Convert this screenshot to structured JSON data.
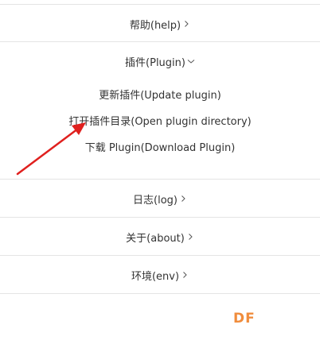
{
  "menu": {
    "help": {
      "label": "帮助(help)",
      "chevron": "chevron-right-icon"
    },
    "plugin": {
      "label": "插件(Plugin)",
      "chevron": "chevron-down-icon",
      "expanded": true,
      "items": [
        {
          "label": "更新插件(Update plugin)"
        },
        {
          "label": "打开插件目录(Open plugin directory)"
        },
        {
          "label": "下载 Plugin(Download Plugin)"
        }
      ]
    },
    "log": {
      "label": "日志(log)",
      "chevron": "chevron-right-icon"
    },
    "about": {
      "label": "关于(about)",
      "chevron": "chevron-right-icon"
    },
    "env": {
      "label": "环境(env)",
      "chevron": "chevron-right-icon"
    }
  },
  "annotation": {
    "arrow_color": "#e0201e",
    "points_to": "打开插件目录(Open plugin directory)"
  },
  "watermark": {
    "text": "DF",
    "color": "#f08c3c"
  },
  "colors": {
    "text": "#333333",
    "divider": "#e4e4e4",
    "background": "#ffffff"
  }
}
